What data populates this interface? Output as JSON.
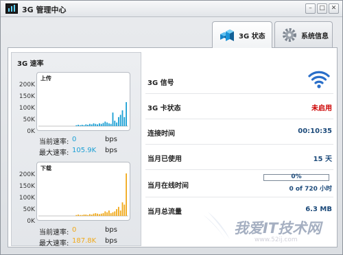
{
  "window": {
    "title": "3G 管理中心"
  },
  "tabs": [
    {
      "label": "3G 状态",
      "icon": "status-bars-icon",
      "active": true
    },
    {
      "label": "系统信息",
      "icon": "gear-icon",
      "active": false
    }
  ],
  "speed_panel": {
    "title": "3G 速率",
    "upload": {
      "label": "上传",
      "y_ticks": [
        "200K",
        "150K",
        "100K",
        "50K",
        "0K"
      ],
      "color": "#1a9fd4",
      "current_label": "当前速率:",
      "current_value": "0",
      "max_label": "最大速率:",
      "max_value": "105.9K",
      "unit": "bps",
      "bars": [
        0.02,
        0.03,
        0.02,
        0.03,
        0.02,
        0.04,
        0.03,
        0.05,
        0.04,
        0.06,
        0.05,
        0.04,
        0.06,
        0.05,
        0.07,
        0.1,
        0.08,
        0.06,
        0.05,
        0.3,
        0.12,
        0.08,
        0.2,
        0.25,
        0.35,
        0.2,
        0.53
      ]
    },
    "download": {
      "label": "下载",
      "y_ticks": [
        "200K",
        "150K",
        "100K",
        "50K",
        "0K"
      ],
      "color": "#f0a818",
      "current_label": "当前速率:",
      "current_value": "0",
      "max_label": "最大速率:",
      "max_value": "187.8K",
      "unit": "bps",
      "bars": [
        0.02,
        0.03,
        0.02,
        0.02,
        0.03,
        0.03,
        0.02,
        0.04,
        0.03,
        0.05,
        0.06,
        0.05,
        0.04,
        0.05,
        0.06,
        0.1,
        0.08,
        0.12,
        0.06,
        0.08,
        0.1,
        0.15,
        0.2,
        0.12,
        0.3,
        0.25,
        0.94
      ]
    }
  },
  "stats": {
    "signal": {
      "label": "3G 信号",
      "icon": "wifi-signal-icon"
    },
    "card_status": {
      "label": "3G 卡状态",
      "value": "未启用",
      "value_color": "#cc0000"
    },
    "connect_time": {
      "label": "连接时间",
      "value": "00:10:35"
    },
    "month_used": {
      "label": "当月已使用",
      "value": "15 天"
    },
    "month_online": {
      "label": "当月在线时间",
      "percent": "0%",
      "progress": 0,
      "detail": "0 of 720 小时"
    },
    "month_traffic": {
      "label": "当月总流量",
      "value": "6.3 MB"
    }
  },
  "watermark": {
    "text": "我爱IT技术网",
    "url": "www.52ij.com"
  }
}
